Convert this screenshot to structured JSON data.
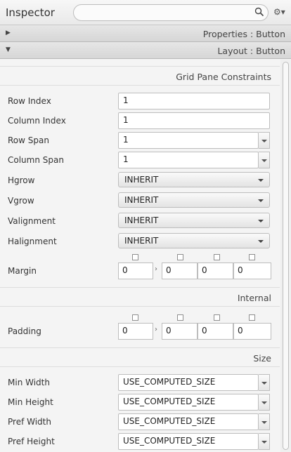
{
  "header": {
    "title": "Inspector",
    "search_value": ""
  },
  "accordions": [
    {
      "label": "Properties : Button",
      "arrow": "▶"
    },
    {
      "label": "Layout : Button",
      "arrow": "▼"
    }
  ],
  "sections": {
    "grid": "Grid Pane Constraints",
    "internal": "Internal",
    "size": "Size"
  },
  "grid": {
    "row_index": {
      "label": "Row Index",
      "value": "1"
    },
    "column_index": {
      "label": "Column Index",
      "value": "1"
    },
    "row_span": {
      "label": "Row Span",
      "value": "1"
    },
    "column_span": {
      "label": "Column Span",
      "value": "1"
    },
    "hgrow": {
      "label": "Hgrow",
      "value": "INHERIT"
    },
    "vgrow": {
      "label": "Vgrow",
      "value": "INHERIT"
    },
    "valignment": {
      "label": "Valignment",
      "value": "INHERIT"
    },
    "halignment": {
      "label": "Halignment",
      "value": "INHERIT"
    },
    "margin": {
      "label": "Margin",
      "values": [
        "0",
        "0",
        "0",
        "0"
      ]
    }
  },
  "internal": {
    "padding": {
      "label": "Padding",
      "values": [
        "0",
        "0",
        "0",
        "0"
      ]
    }
  },
  "size": {
    "min_width": {
      "label": "Min Width",
      "value": "USE_COMPUTED_SIZE"
    },
    "min_height": {
      "label": "Min Height",
      "value": "USE_COMPUTED_SIZE"
    },
    "pref_width": {
      "label": "Pref Width",
      "value": "USE_COMPUTED_SIZE"
    },
    "pref_height": {
      "label": "Pref Height",
      "value": "USE_COMPUTED_SIZE"
    }
  },
  "link_glyph": "›"
}
